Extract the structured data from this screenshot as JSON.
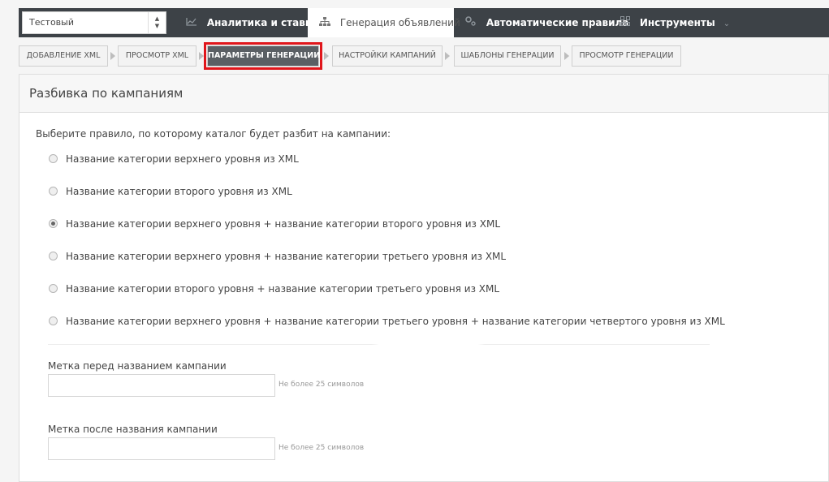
{
  "account": {
    "selected": "Тестовый"
  },
  "nav": [
    {
      "label": "Аналитика и ставки",
      "icon": "line-chart-icon",
      "active": false
    },
    {
      "label": "Генерация объявлений",
      "icon": "sitemap-icon",
      "active": true
    },
    {
      "label": "Автоматические правила",
      "icon": "gears-icon",
      "active": false
    },
    {
      "label": "Инструменты",
      "icon": "grid-icon",
      "active": false
    }
  ],
  "steps": [
    {
      "label": "ДОБАВЛЕНИЕ XML"
    },
    {
      "label": "ПРОСМОТР XML"
    },
    {
      "label": "ПАРАМЕТРЫ ГЕНЕРАЦИИ",
      "active": true
    },
    {
      "label": "НАСТРОЙКИ КАМПАНИЙ"
    },
    {
      "label": "ШАБЛОНЫ ГЕНЕРАЦИИ"
    },
    {
      "label": "ПРОСМОТР ГЕНЕРАЦИИ"
    }
  ],
  "panel": {
    "title": "Разбивка по кампаниям",
    "prompt": "Выберите правило, по которому каталог будет разбит на кампании:",
    "options": [
      {
        "label": "Название категории верхнего уровня из XML",
        "checked": false
      },
      {
        "label": "Название категории второго уровня из XML",
        "checked": false
      },
      {
        "label": "Название категории верхнего уровня + название категории второго уровня из XML",
        "checked": true
      },
      {
        "label": "Название категории верхнего уровня + название категории третьего уровня из XML",
        "checked": false
      },
      {
        "label": "Название категории второго уровня + название категории третьего уровня из XML",
        "checked": false
      },
      {
        "label": "Название категории верхнего уровня + название категории третьего уровня + название категории четвертого уровня из XML",
        "checked": false
      }
    ],
    "prefix_field": {
      "label": "Метка перед названием кампании",
      "value": "",
      "hint": "Не более 25 символов"
    },
    "suffix_field": {
      "label": "Метка после названия кампании",
      "value": "",
      "hint": "Не более 25 символов"
    }
  }
}
